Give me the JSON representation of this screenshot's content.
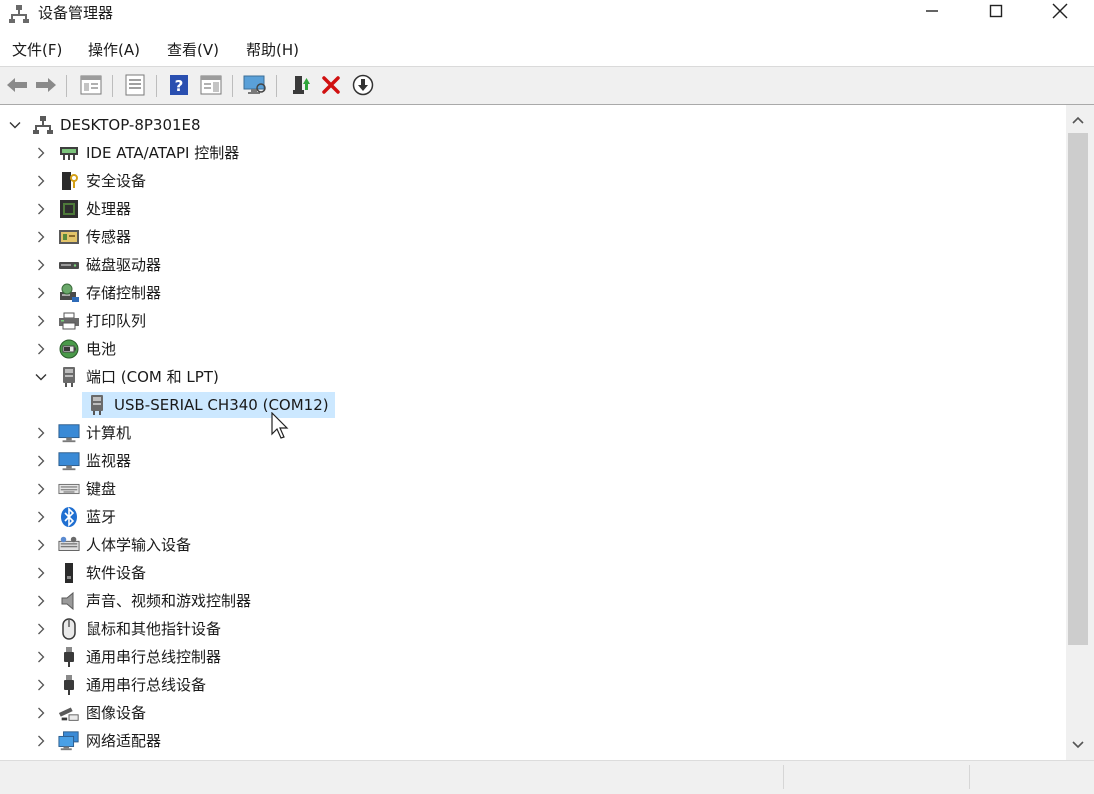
{
  "window": {
    "title": "设备管理器",
    "app_icon": "device-manager-icon",
    "controls": [
      "minimize-icon",
      "maximize-icon",
      "close-icon"
    ]
  },
  "menu": [
    {
      "label": "文件(F)"
    },
    {
      "label": "操作(A)"
    },
    {
      "label": "查看(V)"
    },
    {
      "label": "帮助(H)"
    }
  ],
  "toolbar": {
    "buttons": [
      "back-arrow-icon",
      "forward-arrow-icon",
      "show-hide-tree-icon",
      "properties-icon",
      "help-icon",
      "action-pane-icon",
      "scan-hardware-icon",
      "update-driver-icon",
      "uninstall-device-icon",
      "disable-device-icon"
    ]
  },
  "tree": {
    "root": {
      "label": "DESKTOP-8P301E8",
      "expanded": true
    },
    "categories": [
      {
        "label": "IDE ATA/ATAPI 控制器",
        "icon": "ide-controller-icon"
      },
      {
        "label": "安全设备",
        "icon": "security-device-icon"
      },
      {
        "label": "处理器",
        "icon": "processor-icon"
      },
      {
        "label": "传感器",
        "icon": "sensor-icon"
      },
      {
        "label": "磁盘驱动器",
        "icon": "disk-drive-icon"
      },
      {
        "label": "存储控制器",
        "icon": "storage-controller-icon"
      },
      {
        "label": "打印队列",
        "icon": "printer-icon"
      },
      {
        "label": "电池",
        "icon": "battery-icon"
      },
      {
        "label": "端口 (COM 和 LPT)",
        "icon": "port-icon",
        "expanded": true,
        "children": [
          {
            "label": "USB-SERIAL CH340 (COM12)",
            "icon": "port-icon",
            "selected": true
          }
        ]
      },
      {
        "label": "计算机",
        "icon": "computer-icon"
      },
      {
        "label": "监视器",
        "icon": "monitor-icon"
      },
      {
        "label": "键盘",
        "icon": "keyboard-icon"
      },
      {
        "label": "蓝牙",
        "icon": "bluetooth-icon"
      },
      {
        "label": "人体学输入设备",
        "icon": "hid-icon"
      },
      {
        "label": "软件设备",
        "icon": "software-device-icon"
      },
      {
        "label": "声音、视频和游戏控制器",
        "icon": "speaker-icon"
      },
      {
        "label": "鼠标和其他指针设备",
        "icon": "mouse-icon"
      },
      {
        "label": "通用串行总线控制器",
        "icon": "usb-controller-icon"
      },
      {
        "label": "通用串行总线设备",
        "icon": "usb-device-icon"
      },
      {
        "label": "图像设备",
        "icon": "imaging-device-icon"
      },
      {
        "label": "网络适配器",
        "icon": "network-adapter-icon"
      }
    ]
  },
  "colors": {
    "selection": "#cce8ff",
    "toolbar_bg": "#f0f0f0",
    "delete_red": "#d01010",
    "help_blue": "#2a4fb0"
  }
}
